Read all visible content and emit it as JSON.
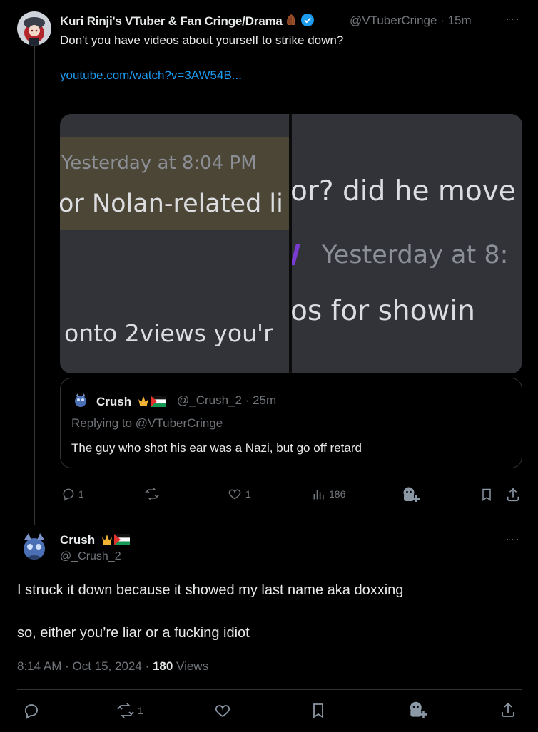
{
  "parent_tweet": {
    "author_name": "Kuri Rinji's VTuber & Fan Cringe/Drama",
    "handle": "@VTuberCringe",
    "time": "15m",
    "text": "Don't you have videos about yourself to strike down?",
    "link": "youtube.com/watch?v=3AW54B...",
    "media": {
      "left_lines": [
        "Yesterday at 8:04 PM",
        "or Nolan-related li",
        "onto 2views you'r"
      ],
      "right_lines": [
        "or? did he move",
        "Yesterday at 8:",
        "os for showin"
      ]
    },
    "quote": {
      "author_name": "Crush",
      "handle": "@_Crush_2",
      "time": "25m",
      "replying_to": "Replying to @VTuberCringe",
      "text": "The guy who shot his ear was a Nazi, but go off retard"
    },
    "actions": {
      "replies": "1",
      "likes": "1",
      "views": "186"
    }
  },
  "main_tweet": {
    "author_name": "Crush",
    "handle": "@_Crush_2",
    "text_line1": "I struck it down because it showed my last name aka doxxing",
    "text_line2": "so, either you’re liar or a fucking idiot",
    "timestamp": "8:14 AM · Oct 15, 2024 · ",
    "views_count": "180",
    "views_label": " Views",
    "actions": {
      "retweets": "1"
    }
  },
  "colors": {
    "background": "#000000",
    "text": "#e7e9ea",
    "muted": "#71767b",
    "link": "#1d9bf0",
    "verified": "#1d9bf0"
  },
  "icons": [
    "verified-icon",
    "reply-icon",
    "retweet-icon",
    "like-icon",
    "views-icon",
    "grok-icon",
    "bookmark-icon",
    "share-icon",
    "more-icon",
    "crown-icon",
    "flag-icon",
    "nut-icon"
  ]
}
